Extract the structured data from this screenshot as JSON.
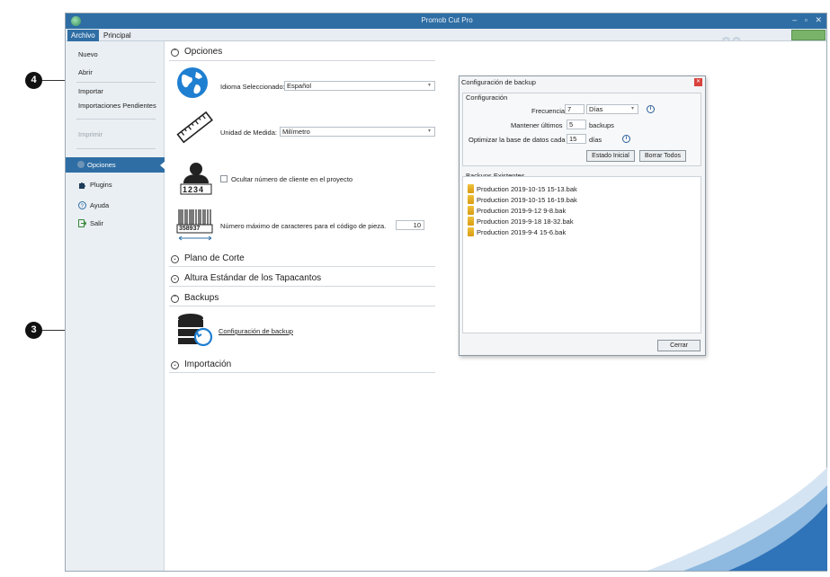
{
  "window": {
    "title": "Promob Cut Pro"
  },
  "ribbon": {
    "tabs": [
      "Archivo",
      "Principal"
    ]
  },
  "menu": {
    "items": [
      "Nuevo",
      "Abrir",
      "Importar",
      "Importaciones Pendientes",
      "Imprimir"
    ],
    "selected": "Opciones",
    "lower": [
      "Plugins",
      "Ayuda",
      "Salir"
    ]
  },
  "content": {
    "options_header": "Opciones",
    "language_label": "Idioma Seleccionado:",
    "language_value": "Español",
    "unit_label": "Unidad de Medida:",
    "unit_value": "Milímetro",
    "client_checkbox_label": "Ocultar número de cliente en el proyecto",
    "client_icon_text": "1234",
    "barcode_text": "358937",
    "max_chars_label": "Número máximo de caracteres para el código de pieza.",
    "max_chars_value": "10",
    "plano_header": "Plano de Corte",
    "altura_header": "Altura Estándar de los Tapacantos",
    "backups_header": "Backups",
    "backup_link": "Configuración de backup",
    "importacion_header": "Importación"
  },
  "dialog": {
    "title": "Configuración de backup",
    "config_group": "Configuración",
    "frequency_label": "Frecuencia",
    "frequency_value": "7",
    "frequency_unit": "Días",
    "keep_label": "Mantener últimos",
    "keep_value": "5",
    "keep_unit": "backups",
    "optimize_label": "Optimizar la base de datos cada",
    "optimize_value": "15",
    "optimize_unit": "días",
    "btn_initial": "Estado Inicial",
    "btn_clear": "Borrar Todos",
    "existing_group": "Backups Existentes",
    "backups": [
      "Production 2019-10-15 15-13.bak",
      "Production 2019-10-15 16-19.bak",
      "Production 2019-9-12 9-8.bak",
      "Production 2019-9-18 18-32.bak",
      "Production 2019-9-4 15-6.bak"
    ],
    "btn_close": "Cerrar"
  },
  "callouts": {
    "three": "3",
    "four": "4"
  },
  "colors": {
    "accent": "#2f6ea4",
    "close": "#d9413b",
    "globe": "#1f7fd1"
  }
}
